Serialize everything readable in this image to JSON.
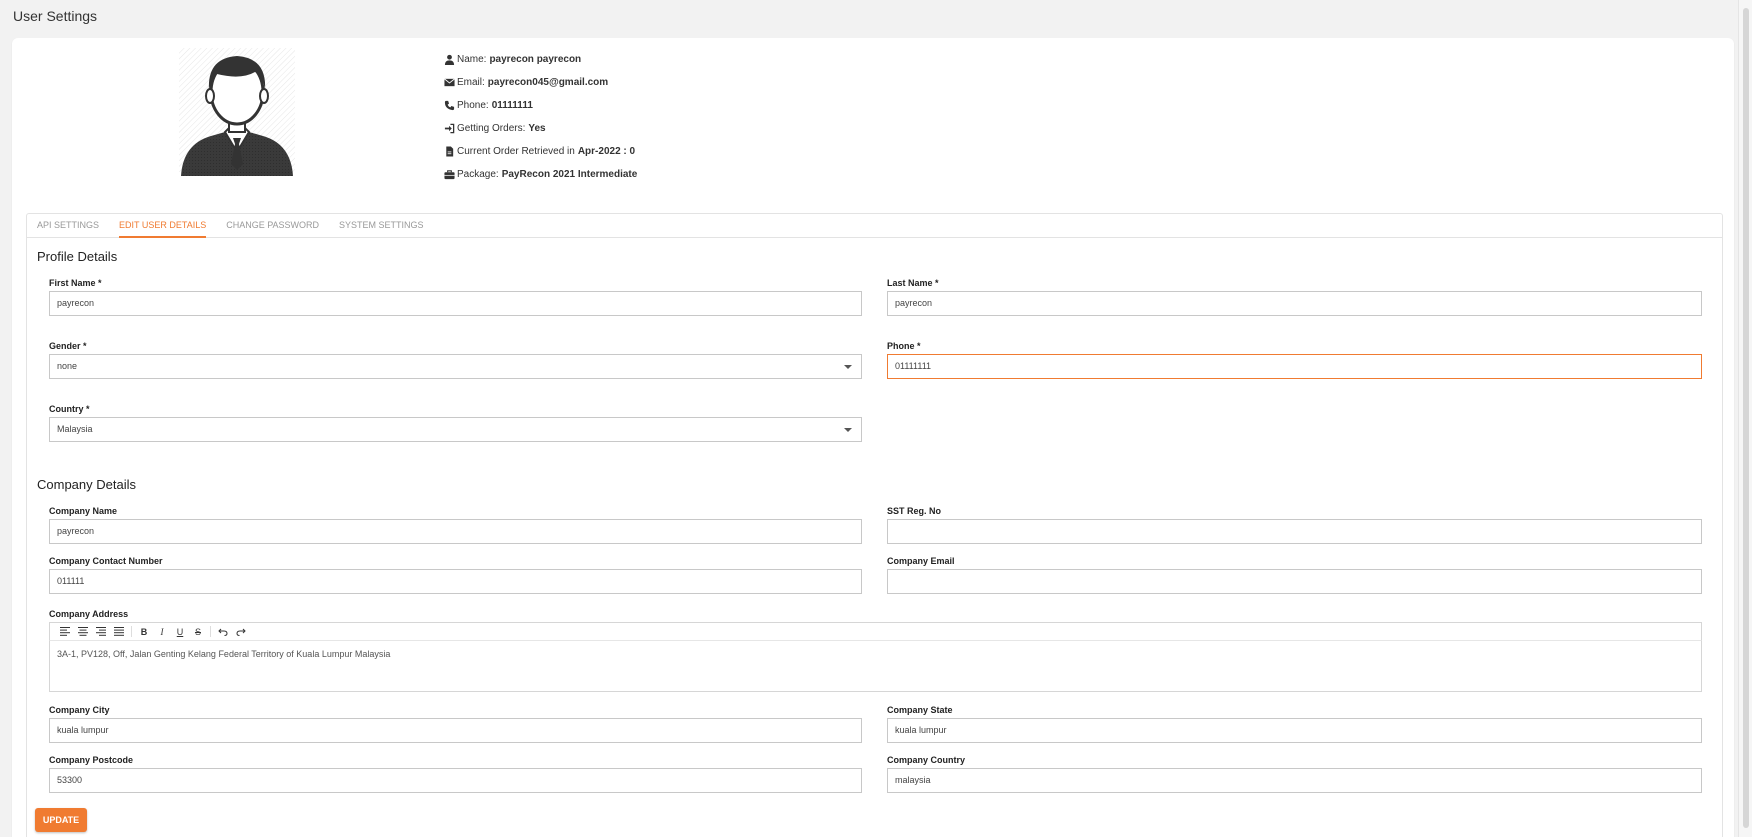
{
  "page": {
    "title": "User Settings"
  },
  "profile": {
    "name_label": "Name:",
    "name_value": "payrecon payrecon",
    "email_label": "Email:",
    "email_value": "payrecon045@gmail.com",
    "phone_label": "Phone:",
    "phone_value": "01111111",
    "orders_label": "Getting Orders:",
    "orders_value": "Yes",
    "retrieved_label": "Current Order Retrieved in",
    "retrieved_value": "Apr-2022 : 0",
    "package_label": "Package:",
    "package_value": "PayRecon 2021 Intermediate"
  },
  "tabs": [
    {
      "label": "API SETTINGS"
    },
    {
      "label": "EDIT USER DETAILS",
      "active": true
    },
    {
      "label": "CHANGE PASSWORD"
    },
    {
      "label": "SYSTEM SETTINGS"
    }
  ],
  "profile_details": {
    "title": "Profile Details",
    "first_name": {
      "label": "First Name *",
      "value": "payrecon"
    },
    "last_name": {
      "label": "Last Name *",
      "value": "payrecon"
    },
    "gender": {
      "label": "Gender *",
      "value": "none"
    },
    "phone": {
      "label": "Phone *",
      "value": "01111111"
    },
    "country": {
      "label": "Country *",
      "value": "Malaysia"
    }
  },
  "company_details": {
    "title": "Company Details",
    "name": {
      "label": "Company Name",
      "value": "payrecon"
    },
    "sst": {
      "label": "SST Reg. No",
      "value": ""
    },
    "contact": {
      "label": "Company Contact Number",
      "value": "011111"
    },
    "email": {
      "label": "Company Email",
      "value": ""
    },
    "address": {
      "label": "Company Address",
      "value": "3A-1, PV128, Off, Jalan Genting Kelang Federal Territory of Kuala Lumpur Malaysia"
    },
    "city": {
      "label": "Company City",
      "value": "kuala lumpur"
    },
    "state": {
      "label": "Company State",
      "value": "kuala lumpur"
    },
    "postcode": {
      "label": "Company Postcode",
      "value": "53300"
    },
    "country": {
      "label": "Company Country",
      "value": "malaysia"
    }
  },
  "toolbar": {
    "buttons": [
      "align-left-icon",
      "align-center-icon",
      "align-right-icon",
      "align-justify-icon",
      "bold-icon",
      "italic-icon",
      "underline-icon",
      "strikethrough-icon",
      "undo-icon",
      "redo-icon"
    ],
    "bold": "B",
    "italic": "I",
    "underline": "U",
    "strike": "S"
  },
  "actions": {
    "update_label": "UPDATE"
  },
  "colors": {
    "accent": "#f07b31",
    "background": "#f2f2f2"
  }
}
